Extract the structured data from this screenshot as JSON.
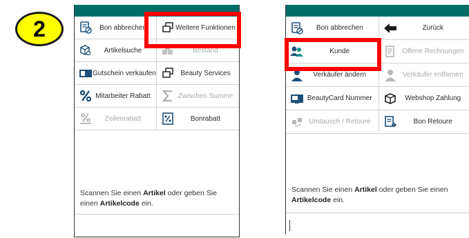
{
  "step": {
    "number": "2"
  },
  "colors": {
    "topbar": "#006e68",
    "highlight": "#ff0000",
    "badge": "#ffff00"
  },
  "panel_a": {
    "buttons": [
      {
        "label": "Bon abbrechen",
        "icon": "receipt-cancel-icon",
        "disabled": false
      },
      {
        "label": "Weitere Funktionen",
        "icon": "windows-stack-icon",
        "disabled": false
      },
      {
        "label": "Artikelsuche",
        "icon": "box-search-icon",
        "disabled": false
      },
      {
        "label": "Bestand",
        "icon": "stock-boxes-icon",
        "disabled": true
      },
      {
        "label": "Gutschein verkaufen",
        "icon": "voucher-card-icon",
        "disabled": false
      },
      {
        "label": "Beauty Services",
        "icon": "windows-stack-icon",
        "disabled": false
      },
      {
        "label": "Mitarbeiter Rabatt",
        "icon": "percent-icon",
        "disabled": false
      },
      {
        "label": "Zwischen Summe",
        "icon": "sigma-icon",
        "disabled": true
      },
      {
        "label": "Zeilenrabatt",
        "icon": "percent-underline-icon",
        "disabled": true
      },
      {
        "label": "Bonrabatt",
        "icon": "percent-document-icon",
        "disabled": false
      }
    ],
    "message": {
      "pre": "Scannen Sie einen ",
      "bold1": "Artikel",
      "mid": " oder geben Sie einen ",
      "bold2": "Artikelcode",
      "post": " ein."
    }
  },
  "panel_b": {
    "buttons": [
      {
        "label": "Bon abbrechen",
        "icon": "receipt-cancel-icon",
        "disabled": false
      },
      {
        "label": "Zurück",
        "icon": "arrow-left-icon",
        "disabled": false
      },
      {
        "label": "Kunde",
        "icon": "customer-group-icon",
        "disabled": false
      },
      {
        "label": "Offene Rechnungen",
        "icon": "open-invoices-icon",
        "disabled": true
      },
      {
        "label": "Verkäufer ändern",
        "icon": "seller-change-icon",
        "disabled": false
      },
      {
        "label": "Verkäufer entfernen",
        "icon": "seller-remove-icon",
        "disabled": true
      },
      {
        "label": "BeautyCard Nummer",
        "icon": "beauty-card-icon",
        "disabled": false
      },
      {
        "label": "Webshop Zahlung",
        "icon": "webshop-box-icon",
        "disabled": false
      },
      {
        "label": "Umtausch / Retoure",
        "icon": "exchange-icon",
        "disabled": true
      },
      {
        "label": "Bon Retoure",
        "icon": "receipt-return-icon",
        "disabled": false
      }
    ],
    "message": {
      "pre": "Scannen Sie einen ",
      "bold1": "Artikel",
      "mid": " oder geben Sie einen ",
      "bold2": "Artikelcode",
      "post": " ein."
    }
  }
}
